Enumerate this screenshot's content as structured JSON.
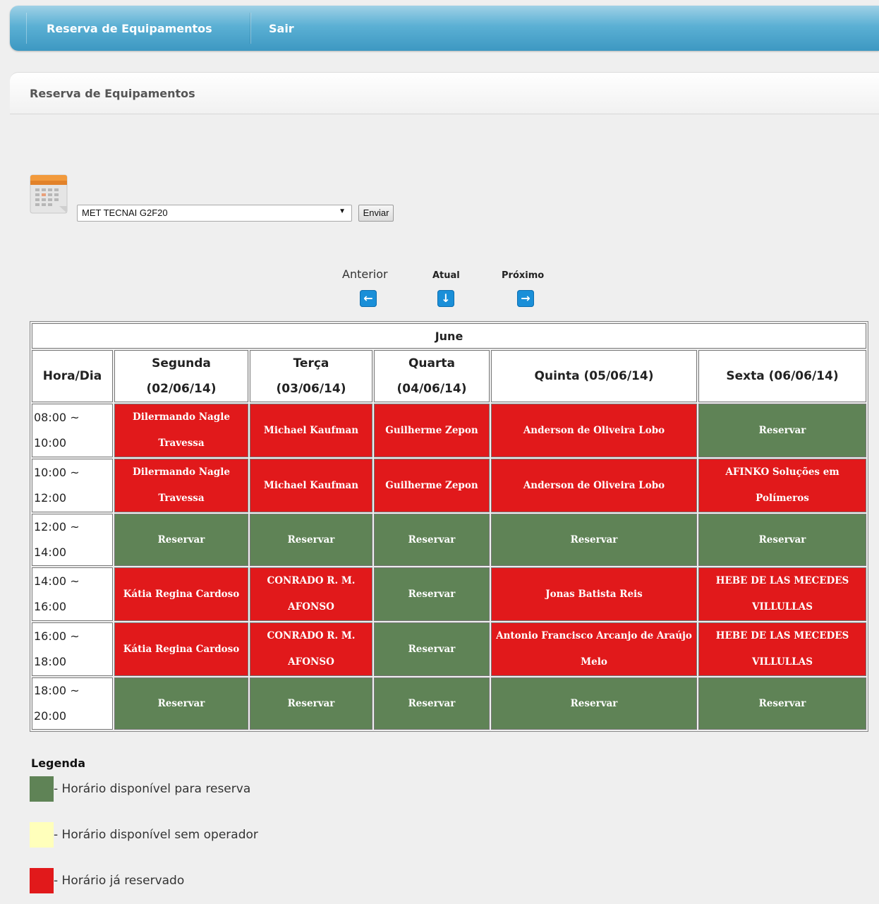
{
  "nav": {
    "items": [
      "Reserva de Equipamentos",
      "Sair"
    ]
  },
  "panel": {
    "title": "Reserva de Equipamentos"
  },
  "form": {
    "selected_equipment": "MET TECNAI G2F20",
    "submit_label": "Enviar"
  },
  "week_nav": {
    "prev_label": "Anterior",
    "current_label": "Atual",
    "next_label": "Próximo"
  },
  "schedule": {
    "month": "June",
    "corner_header": "Hora/Dia",
    "days": [
      {
        "name": "Segunda",
        "date": "(02/06/14)"
      },
      {
        "name": "Terça",
        "date": "(03/06/14)"
      },
      {
        "name": "Quarta",
        "date": "(04/06/14)"
      },
      {
        "name": "Quinta",
        "date": "(05/06/14)"
      },
      {
        "name": "Sexta",
        "date": "(06/06/14)"
      }
    ],
    "rows": [
      {
        "start": "08:00 ~",
        "end": "10:00",
        "slots": [
          {
            "status": "booked",
            "text": "Dilermando Nagle Travessa"
          },
          {
            "status": "booked",
            "text": "Michael Kaufman"
          },
          {
            "status": "booked",
            "text": "Guilherme Zepon"
          },
          {
            "status": "booked",
            "text": "Anderson de Oliveira Lobo"
          },
          {
            "status": "free",
            "text": "Reservar"
          }
        ]
      },
      {
        "start": "10:00 ~",
        "end": "12:00",
        "slots": [
          {
            "status": "booked",
            "text": "Dilermando Nagle Travessa"
          },
          {
            "status": "booked",
            "text": "Michael Kaufman"
          },
          {
            "status": "booked",
            "text": "Guilherme Zepon"
          },
          {
            "status": "booked",
            "text": "Anderson de Oliveira Lobo"
          },
          {
            "status": "booked",
            "text": "AFINKO Soluções em Polímeros"
          }
        ]
      },
      {
        "start": "12:00 ~",
        "end": "14:00",
        "slots": [
          {
            "status": "free",
            "text": "Reservar"
          },
          {
            "status": "free",
            "text": "Reservar"
          },
          {
            "status": "free",
            "text": "Reservar"
          },
          {
            "status": "free",
            "text": "Reservar"
          },
          {
            "status": "free",
            "text": "Reservar"
          }
        ]
      },
      {
        "start": "14:00 ~",
        "end": "16:00",
        "slots": [
          {
            "status": "booked",
            "text": "Kátia Regina Cardoso"
          },
          {
            "status": "booked",
            "text": "CONRADO R. M. AFONSO"
          },
          {
            "status": "free",
            "text": "Reservar"
          },
          {
            "status": "booked",
            "text": "Jonas Batista Reis"
          },
          {
            "status": "booked",
            "text": "HEBE DE LAS MECEDES VILLULLAS"
          }
        ]
      },
      {
        "start": "16:00 ~",
        "end": "18:00",
        "slots": [
          {
            "status": "booked",
            "text": "Kátia Regina Cardoso"
          },
          {
            "status": "booked",
            "text": "CONRADO R. M. AFONSO"
          },
          {
            "status": "free",
            "text": "Reservar"
          },
          {
            "status": "booked",
            "text": "Antonio Francisco Arcanjo de Araújo Melo"
          },
          {
            "status": "booked",
            "text": "HEBE DE LAS MECEDES VILLULLAS"
          }
        ]
      },
      {
        "start": "18:00 ~",
        "end": "20:00",
        "slots": [
          {
            "status": "free",
            "text": "Reservar"
          },
          {
            "status": "free",
            "text": "Reservar"
          },
          {
            "status": "free",
            "text": "Reservar"
          },
          {
            "status": "free",
            "text": "Reservar"
          },
          {
            "status": "free",
            "text": "Reservar"
          }
        ]
      }
    ]
  },
  "legend": {
    "title": "Legenda",
    "items": [
      {
        "color": "#5f8356",
        "text": "- Horário disponível para reserva"
      },
      {
        "color": "#ffffbb",
        "text": "- Horário disponível sem operador"
      },
      {
        "color": "#e1191b",
        "text": "- Horário já reservado"
      }
    ]
  },
  "colors": {
    "free": "#5f8356",
    "booked": "#e1191b",
    "no_operator": "#ffffbb",
    "nav_bar": "#3d98c2"
  },
  "icons": {
    "calendar": "calendar-icon",
    "prev": "arrow-left-icon",
    "current": "arrow-down-icon",
    "next": "arrow-right-icon",
    "select_arrow": "triangle-down-icon"
  }
}
